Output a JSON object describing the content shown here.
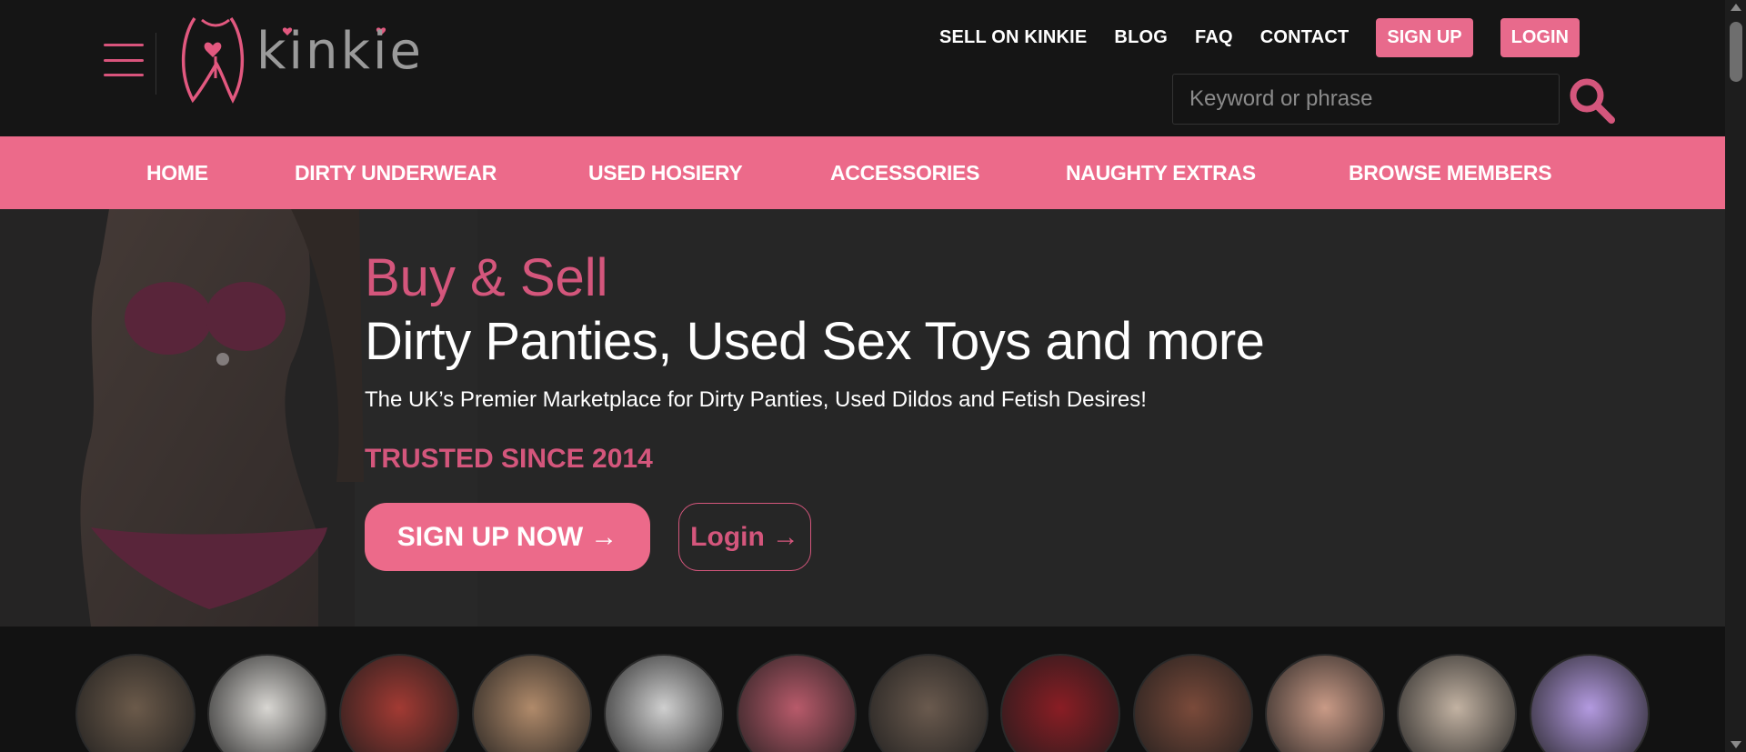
{
  "brand": {
    "logo_text": "kinkie",
    "accent": "#ec6a8a",
    "accent_dark": "#d4567c"
  },
  "topnav": {
    "items": [
      "SELL ON KINKIE",
      "BLOG",
      "FAQ",
      "CONTACT"
    ],
    "signup": "SIGN UP",
    "login": "LOGIN"
  },
  "search": {
    "placeholder": "Keyword or phrase"
  },
  "catnav": [
    "HOME",
    "DIRTY UNDERWEAR",
    "USED HOSIERY",
    "ACCESSORIES",
    "NAUGHTY EXTRAS",
    "BROWSE MEMBERS"
  ],
  "hero": {
    "headline_pink": "Buy & Sell",
    "headline_white": "Dirty Panties, Used Sex Toys and more",
    "subtitle": "The UK’s Premier Marketplace for Dirty Panties, Used Dildos and Fetish Desires!",
    "trusted": "TRUSTED SINCE 2014",
    "cta_signup": "SIGN UP NOW",
    "cta_login": "Login",
    "arrow": "→"
  },
  "avatars": {
    "colors": [
      "#6b5a4a",
      "#d8d6d2",
      "#a23a33",
      "#b08a6a",
      "#cfcfcf",
      "#b85a6a",
      "#6a5a4e",
      "#8a1d24",
      "#7a4a3a",
      "#c99a86",
      "#c2b2a2",
      "#b39ae0"
    ]
  }
}
